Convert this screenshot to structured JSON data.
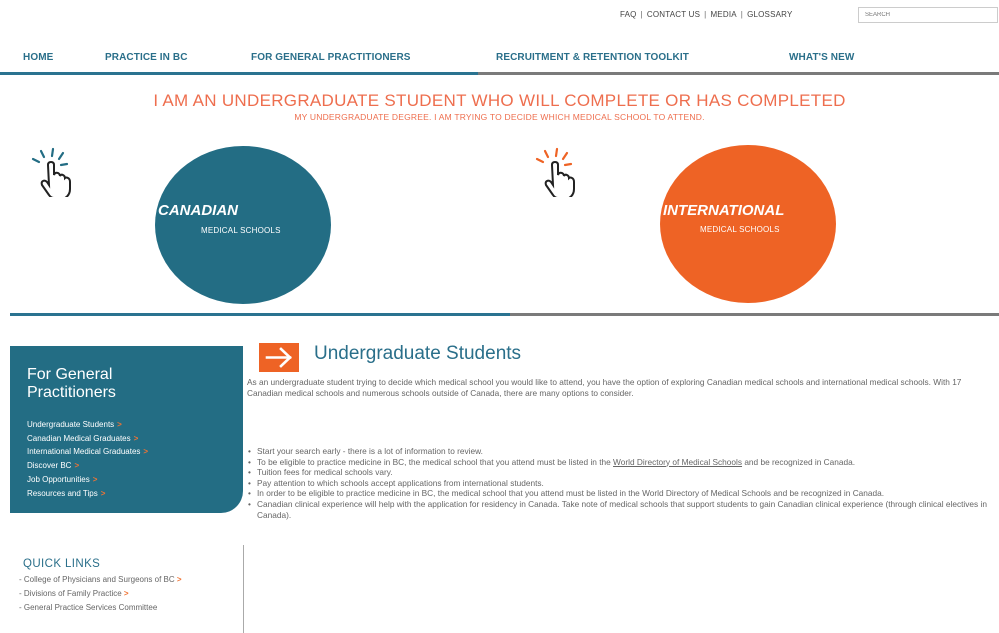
{
  "utility": {
    "faq": "FAQ",
    "contact": "CONTACT US",
    "media": "MEDIA",
    "glossary": "GLOSSARY",
    "separator": "|",
    "search_placeholder": "SEARCH"
  },
  "nav": {
    "home": "HOME",
    "practice": "PRACTICE IN BC",
    "general": "FOR GENERAL PRACTITIONERS",
    "recruitment": "RECRUITMENT & RETENTION TOOLKIT",
    "whats_new": "WHAT'S NEW"
  },
  "hero": {
    "title": "I AM AN UNDERGRADUATE STUDENT WHO WILL COMPLETE OR HAS COMPLETED",
    "subtitle": "MY UNDERGRADUATE DEGREE. I AM TRYING TO DECIDE WHICH MEDICAL SCHOOL TO ATTEND.",
    "canadian_label": "CANADIAN",
    "canadian_sub": "MEDICAL SCHOOLS",
    "international_label": "INTERNATIONAL",
    "international_sub": "MEDICAL SCHOOLS"
  },
  "sidebar": {
    "title": "For General Practitioners",
    "items": [
      {
        "label": "Undergraduate Students"
      },
      {
        "label": "Canadian Medical Graduates"
      },
      {
        "label": "International Medical Graduates"
      },
      {
        "label": "Discover BC"
      },
      {
        "label": "Job Opportunities"
      },
      {
        "label": "Resources and Tips"
      }
    ],
    "arrow": ">"
  },
  "quick_links": {
    "title": "QUICK LINKS",
    "items": [
      {
        "label": "- College of Physicians and Surgeons of BC"
      },
      {
        "label": "- Divisions of Family Practice"
      },
      {
        "label": "- General Practice Services Committee"
      }
    ]
  },
  "content": {
    "title": "Undergraduate Students",
    "intro": "As an undergraduate student trying to decide which medical school you would like to attend, you have the option of exploring Canadian medical schools and international medical schools. With 17 Canadian medical schools and numerous schools outside of Canada, there are many options to consider.",
    "bullets": {
      "b1": "Start your search early - there is a lot of information to review.",
      "b2_pre": "To be eligible to practice medicine in BC, the medical school that you attend must be listed in the ",
      "b2_link": "World Directory of Medical Schools",
      "b2_post": " and be recognized in Canada.",
      "b3": "Tuition fees for medical schools vary.",
      "b4": "Pay attention to which schools accept applications from international students.",
      "b5": "In order to be eligible to practice medicine in BC, the medical school that you attend must be listed in the World Directory of Medical Schools and be recognized in Canada.",
      "b6": "Canadian clinical experience will help with the application for residency in Canada. Take note of medical schools that support students to gain Canadian clinical experience (through clinical electives in Canada)."
    }
  },
  "colors": {
    "teal": "#236d84",
    "orange": "#ee6325",
    "nav_teal_bar": "#2a7390",
    "nav_gray_bar": "#7a7a7a"
  }
}
